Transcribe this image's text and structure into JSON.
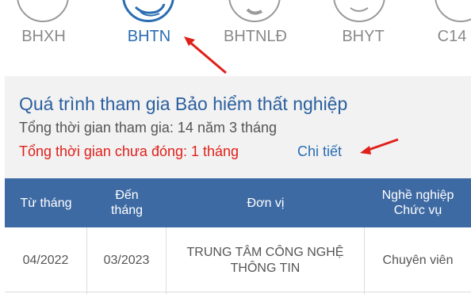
{
  "tabs": [
    {
      "label": "BHXH",
      "active": false
    },
    {
      "label": "BHTN",
      "active": true
    },
    {
      "label": "BHTNLĐ",
      "active": false
    },
    {
      "label": "BHYT",
      "active": false
    },
    {
      "label": "C14",
      "active": false
    }
  ],
  "panel": {
    "title": "Quá trình tham gia Bảo hiểm thất nghiệp",
    "total_time": "Tổng thời gian tham gia: 14 năm 3 tháng",
    "unpaid_time": "Tổng thời gian chưa đóng: 1 tháng",
    "detail_link": "Chi tiết"
  },
  "table": {
    "headers": [
      "Từ tháng",
      "Đến\ntháng",
      "Đơn vị",
      "Nghề nghiệp\nChức vụ"
    ],
    "rows": [
      [
        "04/2022",
        "03/2023",
        "TRUNG TÂM CÔNG NGHỆ\nTHÔNG TIN",
        "Chuyên viên"
      ]
    ]
  },
  "colors": {
    "accent": "#2a6db2",
    "header_bg": "#3e6aa3",
    "alert": "#e0201b",
    "annotation_arrow": "#e0201b"
  }
}
